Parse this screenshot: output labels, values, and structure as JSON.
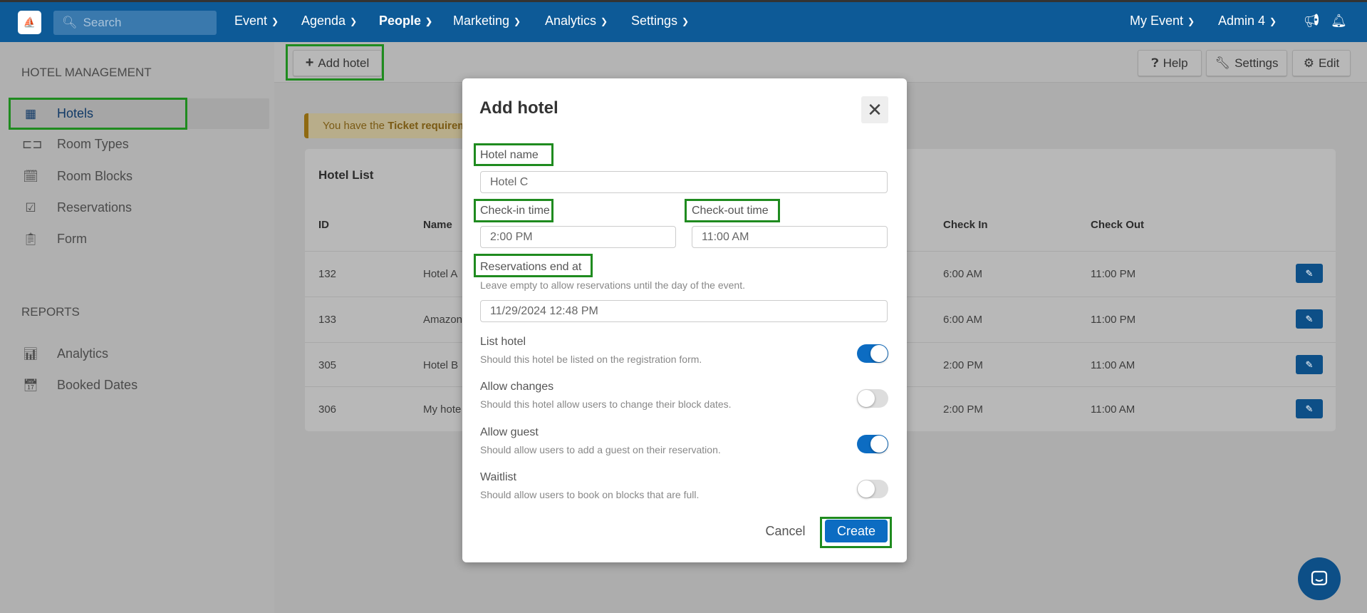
{
  "header": {
    "search_placeholder": "Search",
    "nav": [
      "Event",
      "Agenda",
      "People",
      "Marketing",
      "Analytics",
      "Settings"
    ],
    "event_selector": "My Event",
    "user_menu": "Admin 4",
    "brand_color": "#0d5a97"
  },
  "sidebar": {
    "section1": "HOTEL MANAGEMENT",
    "items": [
      {
        "label": "Hotels",
        "icon": "hotel-icon"
      },
      {
        "label": "Room Types",
        "icon": "bed-icon"
      },
      {
        "label": "Room Blocks",
        "icon": "calendar-edit-icon"
      },
      {
        "label": "Reservations",
        "icon": "calendar-check-icon"
      },
      {
        "label": "Form",
        "icon": "clipboard-icon"
      }
    ],
    "section2": "REPORTS",
    "reports": [
      {
        "label": "Analytics",
        "icon": "chart-icon"
      },
      {
        "label": "Booked Dates",
        "icon": "calendar-icon"
      }
    ]
  },
  "toolbar": {
    "add_hotel": "Add hotel",
    "help": "Help",
    "settings": "Settings",
    "edit": "Edit"
  },
  "alert": {
    "prefix": "You have the ",
    "bold": "Ticket requirem"
  },
  "hotel_list": {
    "title": "Hotel List",
    "columns": {
      "id": "ID",
      "name": "Name",
      "check_in": "Check In",
      "check_out": "Check Out"
    },
    "rows": [
      {
        "id": "132",
        "name": "Hotel A",
        "check_in": "6:00 AM",
        "check_out": "11:00 PM"
      },
      {
        "id": "133",
        "name": "Amazon",
        "check_in": "6:00 AM",
        "check_out": "11:00 PM"
      },
      {
        "id": "305",
        "name": "Hotel B",
        "check_in": "2:00 PM",
        "check_out": "11:00 AM"
      },
      {
        "id": "306",
        "name": "My hote",
        "check_in": "2:00 PM",
        "check_out": "11:00 AM"
      }
    ]
  },
  "modal": {
    "title": "Add hotel",
    "hotel_name_label": "Hotel name",
    "hotel_name_value": "Hotel C",
    "checkin_label": "Check-in time",
    "checkin_value": "2:00 PM",
    "checkout_label": "Check-out time",
    "checkout_value": "11:00 AM",
    "res_end_label": "Reservations end at",
    "res_end_help": "Leave empty to allow reservations until the day of the event.",
    "res_end_value": "11/29/2024 12:48 PM",
    "toggles": [
      {
        "label": "List hotel",
        "desc": "Should this hotel be listed on the registration form.",
        "on": true
      },
      {
        "label": "Allow changes",
        "desc": "Should this hotel allow users to change their block dates.",
        "on": false
      },
      {
        "label": "Allow guest",
        "desc": "Should allow users to add a guest on their reservation.",
        "on": true
      },
      {
        "label": "Waitlist",
        "desc": "Should allow users to book on blocks that are full.",
        "on": false
      }
    ],
    "cancel": "Cancel",
    "create": "Create"
  }
}
